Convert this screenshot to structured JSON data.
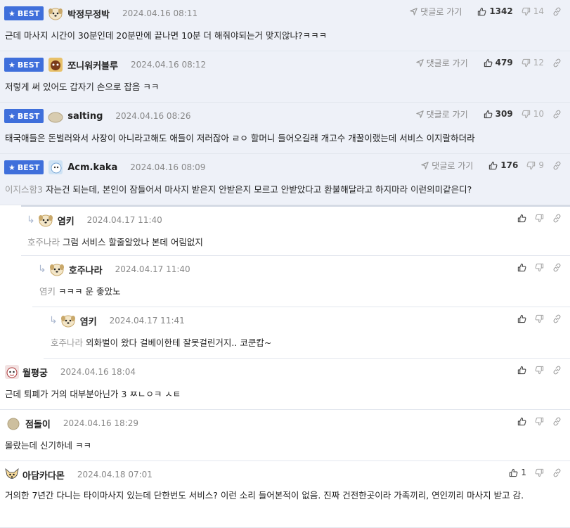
{
  "badge_label": "BEST",
  "goto_label": "댓글로 가기",
  "best": [
    {
      "nick": "박정무정박",
      "date": "2024.04.16 08:11",
      "text": "근데 마사지 시간이 30분인데 20분만에 끝나면 10분 더 해줘야되는거 맞지않냐?ㅋㅋㅋ",
      "up": "1342",
      "down": "14"
    },
    {
      "nick": "쪼니워커블루",
      "date": "2024.04.16 08:12",
      "text": "저렇게 써 있어도 갑자기 손으로 잡음 ㅋㅋ",
      "up": "479",
      "down": "12"
    },
    {
      "nick": "salting",
      "date": "2024.04.16 08:26",
      "text": "태국애들은 돈벌러와서 사장이 아니라고해도 애들이 저러잖아 ㄹㅇ 할머니 들어오길래 개고수 개꿀이랬는데 서비스 이지랄하더라",
      "up": "309",
      "down": "10"
    },
    {
      "nick": "Acm.kaka",
      "date": "2024.04.16 08:09",
      "mention": "이지스함3",
      "text": "자는건 되는데, 본인이 잠들어서 마사지 받은지 안받은지 모르고 안받았다고 환불해달라고 하지마라 이런의미같은디?",
      "up": "176",
      "down": "9"
    }
  ],
  "replies": [
    {
      "nick": "염키",
      "date": "2024.04.17 11:40",
      "mention": "호주나라",
      "text": "그럼 서비스 할줄알았나 본데 어림없지"
    },
    {
      "nick": "호주나라",
      "date": "2024.04.17 11:40",
      "mention": "염키",
      "text": "ㅋㅋㅋ 운 좋았노"
    },
    {
      "nick": "염키",
      "date": "2024.04.17 11:41",
      "mention": "호주나라",
      "text": "외화벌이 왔다 걸베이한테 잘못걸린거지.. 코쿤캅~"
    }
  ],
  "comments": [
    {
      "nick": "월평궁",
      "date": "2024.04.16 18:04",
      "text": "근데 퇴폐가 거의 대부분아닌가 3 ㅉㄴㅇㅋ ㅅㅌ",
      "up": ""
    },
    {
      "nick": "점돌이",
      "date": "2024.04.16 18:29",
      "text": "몰랐는데 신기하네 ㅋㅋ",
      "up": ""
    },
    {
      "nick": "아담카다몬",
      "date": "2024.04.18 07:01",
      "text": "거의한 7년간 다니는 타이마사지 있는데 단한번도 서비스? 이런 소리 들어본적이 없음. 진짜 건전한곳이라 가족끼리, 연인끼리 마사지 받고 감.",
      "up": "1"
    }
  ],
  "colors": {
    "best_bg": "#eef1f8",
    "badge": "#3f6fdb"
  },
  "icons": [
    "star-icon",
    "goto-arrow-icon",
    "thumbs-up-icon",
    "thumbs-down-icon",
    "link-icon",
    "reply-arrow-icon"
  ]
}
